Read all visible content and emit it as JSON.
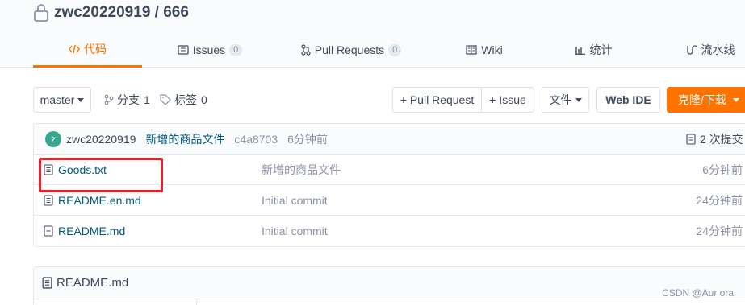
{
  "repo": {
    "title": "zwc20220919 / 666"
  },
  "tabs": [
    {
      "label": "代码",
      "icon": "code-icon",
      "badge": ""
    },
    {
      "label": "Issues",
      "icon": "issues-icon",
      "badge": "0"
    },
    {
      "label": "Pull Requests",
      "icon": "pull-request-icon",
      "badge": "0"
    },
    {
      "label": "Wiki",
      "icon": "wiki-icon",
      "badge": ""
    },
    {
      "label": "统计",
      "icon": "stats-icon",
      "badge": ""
    },
    {
      "label": "流水线",
      "icon": "pipeline-icon",
      "badge": ""
    }
  ],
  "toolbar": {
    "branch": "master",
    "branches_label": "分支",
    "branches_count": "1",
    "tags_label": "标签",
    "tags_count": "0",
    "pull_request": "+ Pull Request",
    "issue": "+ Issue",
    "file": "文件",
    "web_ide": "Web IDE",
    "clone": "克隆/下载"
  },
  "commit": {
    "avatar_letter": "z",
    "author": "zwc20220919",
    "message": "新增的商品文件",
    "hash": "c4a8703",
    "time": "6分钟前",
    "count": "2 次提交"
  },
  "files": [
    {
      "name": "Goods.txt",
      "message": "新增的商品文件",
      "time": "6分钟前"
    },
    {
      "name": "README.en.md",
      "message": "Initial commit",
      "time": "24分钟前"
    },
    {
      "name": "README.md",
      "message": "Initial commit",
      "time": "24分钟前"
    }
  ],
  "readme": {
    "title": "README.md"
  },
  "watermark": "CSDN @Aur ora",
  "colors": {
    "accent": "#fe7300",
    "link": "#005980",
    "highlight": "#e8202a"
  }
}
